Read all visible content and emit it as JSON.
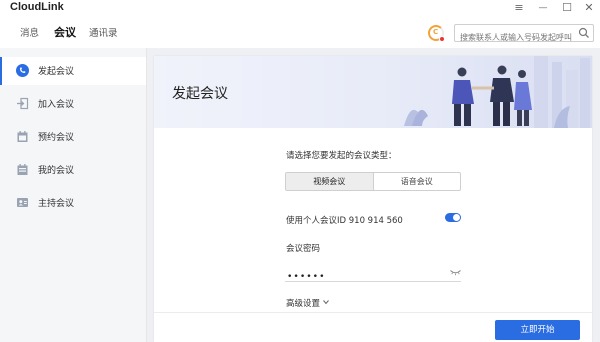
{
  "app": {
    "title": "CloudLink"
  },
  "window_controls": {
    "menu": "≡",
    "minimize": "—",
    "maximize": "☐",
    "close": "✕"
  },
  "nav": {
    "tabs": [
      {
        "label": "消息",
        "active": false
      },
      {
        "label": "会议",
        "active": true
      },
      {
        "label": "通讯录",
        "active": false
      }
    ]
  },
  "search": {
    "placeholder": "搜索联系人或输入号码发起呼叫"
  },
  "sidebar": {
    "items": [
      {
        "label": "发起会议",
        "icon": "phone-icon",
        "active": true
      },
      {
        "label": "加入会议",
        "icon": "enter-icon",
        "active": false
      },
      {
        "label": "预约会议",
        "icon": "calendar-icon",
        "active": false
      },
      {
        "label": "我的会议",
        "icon": "calendar-list-icon",
        "active": false
      },
      {
        "label": "主持会议",
        "icon": "host-icon",
        "active": false
      }
    ]
  },
  "main": {
    "banner_title": "发起会议",
    "prompt": "请选择您要发起的会议类型：",
    "meeting_types": [
      {
        "label": "视频会议",
        "selected": true
      },
      {
        "label": "语音会议",
        "selected": false
      }
    ],
    "personal_meeting": {
      "label": "使用个人会议ID 910 914 560",
      "enabled": true
    },
    "password": {
      "label": "会议密码",
      "value": "••••••"
    },
    "advanced_label": "高级设置",
    "start_button": "立即开始"
  },
  "colors": {
    "accent": "#2a6ce2",
    "sidebar_bg": "#f5f6f8",
    "main_bg": "#eef0f3"
  }
}
